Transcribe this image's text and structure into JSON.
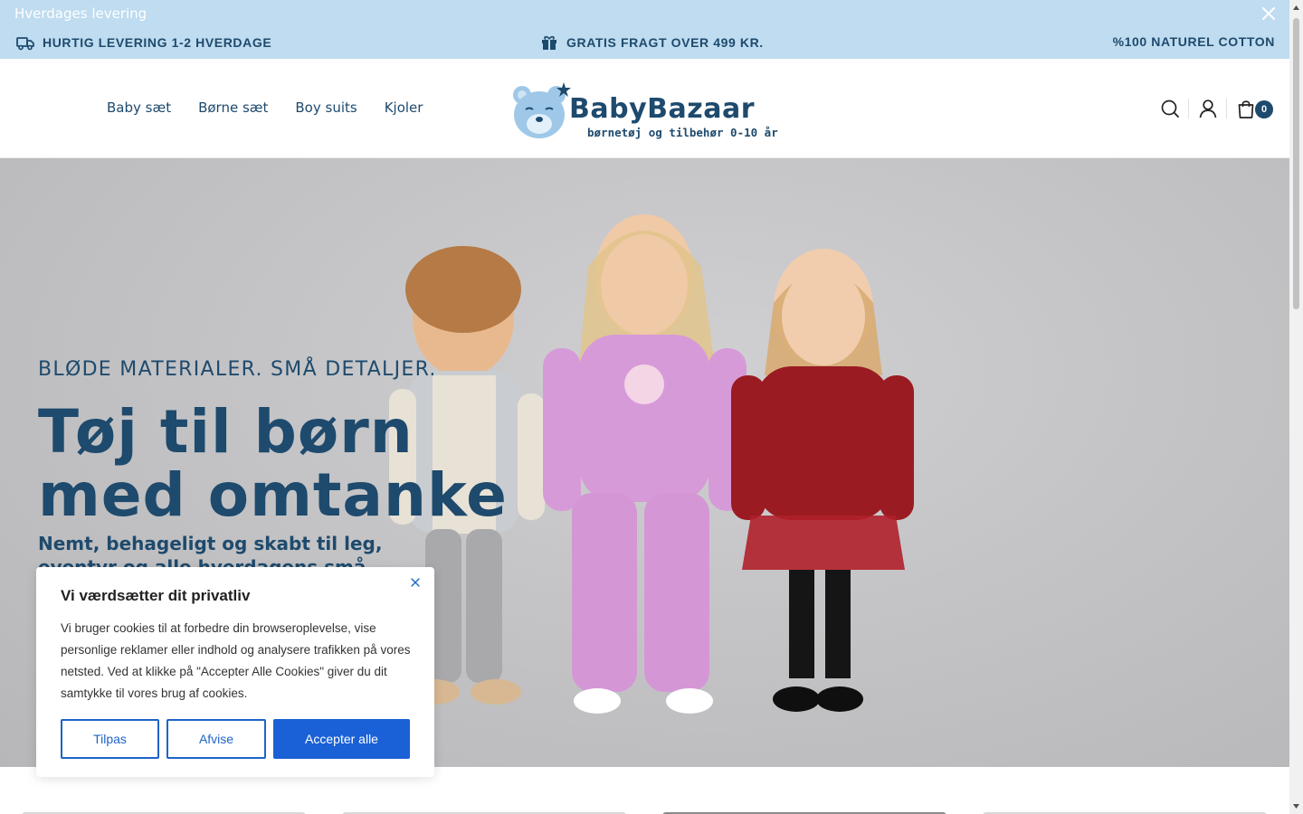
{
  "announcement": {
    "top_text": "Hverdages levering",
    "close_icon": "close-icon",
    "usps": [
      {
        "icon": "truck-icon",
        "text": "HURTIG LEVERING 1-2 HVERDAGE"
      },
      {
        "icon": "gift-icon",
        "text": "GRATIS FRAGT OVER 499 KR."
      },
      {
        "icon": "",
        "text": "%100 NATUREL COTTON"
      }
    ]
  },
  "header": {
    "nav": [
      "Baby sæt",
      "Børne sæt",
      "Boy suits",
      "Kjoler"
    ],
    "logo": {
      "name": "BabyBazaar",
      "tagline": "børnetøj og tilbehør 0-10 år"
    },
    "icons": [
      "search-icon",
      "user-icon",
      "bag-icon"
    ],
    "cart_count": "0"
  },
  "hero": {
    "eyebrow": "BLØDE MATERIALER. SMÅ DETALJER.",
    "title_line1": "Tøj til børn",
    "title_line2": "med omtanke",
    "subtitle": "Nemt, behageligt og skabt til leg, eventyr og alle hverdagens små øjeblikke."
  },
  "cookie": {
    "title": "Vi værdsætter dit privatliv",
    "text": "Vi bruger cookies til at forbedre din browseroplevelse, vise personlige reklamer eller indhold og analysere trafikken på vores netsted. Ved at klikke på \"Accepter Alle Cookies\" giver du dit samtykke til vores brug af cookies.",
    "buttons": {
      "customize": "Tilpas",
      "reject": "Afvise",
      "accept": "Accepter alle"
    }
  },
  "colors": {
    "brand_navy": "#1e4a6d",
    "announcement_bg": "#bfdcf0",
    "accept_blue": "#1a60d6"
  }
}
